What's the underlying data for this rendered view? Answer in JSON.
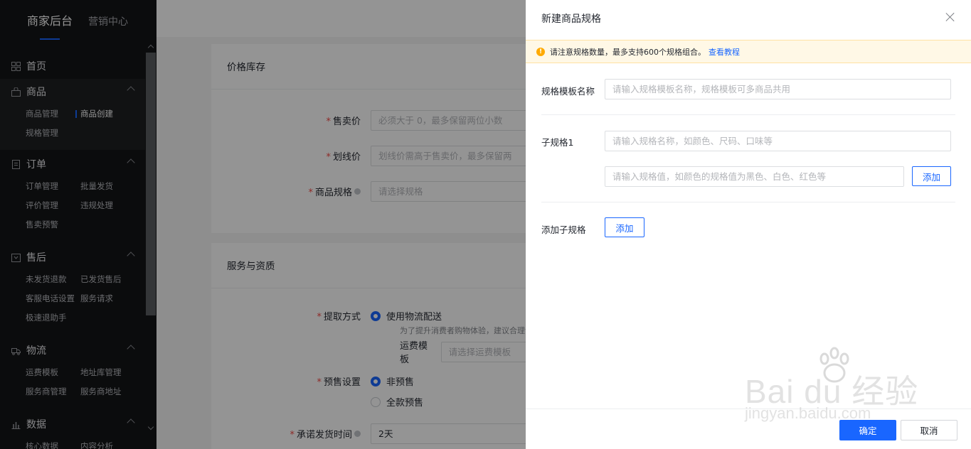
{
  "sidebar": {
    "tabs": [
      "商家后台",
      "营销中心"
    ],
    "home": "首页",
    "groups": [
      {
        "title": "商品",
        "icon": "bag-icon",
        "items": [
          "商品管理",
          "商品创建",
          "规格管理"
        ]
      },
      {
        "title": "订单",
        "icon": "document-icon",
        "items": [
          "订单管理",
          "批量发货",
          "评价管理",
          "违规处理",
          "售卖预警"
        ]
      },
      {
        "title": "售后",
        "icon": "return-icon",
        "items": [
          "未发货退款",
          "已发货售后",
          "客服电话设置",
          "服务请求",
          "极速退助手"
        ]
      },
      {
        "title": "物流",
        "icon": "truck-icon",
        "items": [
          "运费模板",
          "地址库管理",
          "服务商管理",
          "服务商地址"
        ]
      },
      {
        "title": "数据",
        "icon": "chart-icon",
        "items": [
          "核心数据",
          "内容分析"
        ]
      }
    ]
  },
  "main": {
    "card1": {
      "title": "价格库存",
      "price_label": "售卖价",
      "price_placeholder": "必须大于 0，最多保留两位小数",
      "strike_label": "划线价",
      "strike_placeholder": "划线价需高于售卖价，最多保留两",
      "spec_label": "商品规格",
      "spec_placeholder": "请选择规格"
    },
    "card2": {
      "title": "服务与资质",
      "pickup_label": "提取方式",
      "pickup_option": "使用物流配送",
      "pickup_hint": "为了提升消费者购物体验，建议合理设",
      "freight_label": "运费模板",
      "freight_placeholder": "请选择运费模板",
      "presale_label": "预售设置",
      "presale_option1": "非预售",
      "presale_option2": "全款预售",
      "ship_label": "承诺发货时间",
      "ship_value": "2天"
    }
  },
  "drawer": {
    "title": "新建商品规格",
    "notice": "请注意规格数量，最多支持600个规格组合。",
    "notice_link": "查看教程",
    "template_label": "规格模板名称",
    "template_placeholder": "请输入规格模板名称，规格模板可多商品共用",
    "sub_label": "子规格1",
    "sub_name_placeholder": "请输入规格名称，如颜色、尺码、口味等",
    "sub_value_placeholder": "请输入规格值，如颜色的规格值为黑色、白色、红色等",
    "add_value_button": "添加",
    "add_sub_label": "添加子规格",
    "add_sub_button": "添加",
    "confirm": "确定",
    "cancel": "取消"
  },
  "watermark": {
    "text": "Bai du 经验",
    "url": "jingyan.baidu.com"
  }
}
